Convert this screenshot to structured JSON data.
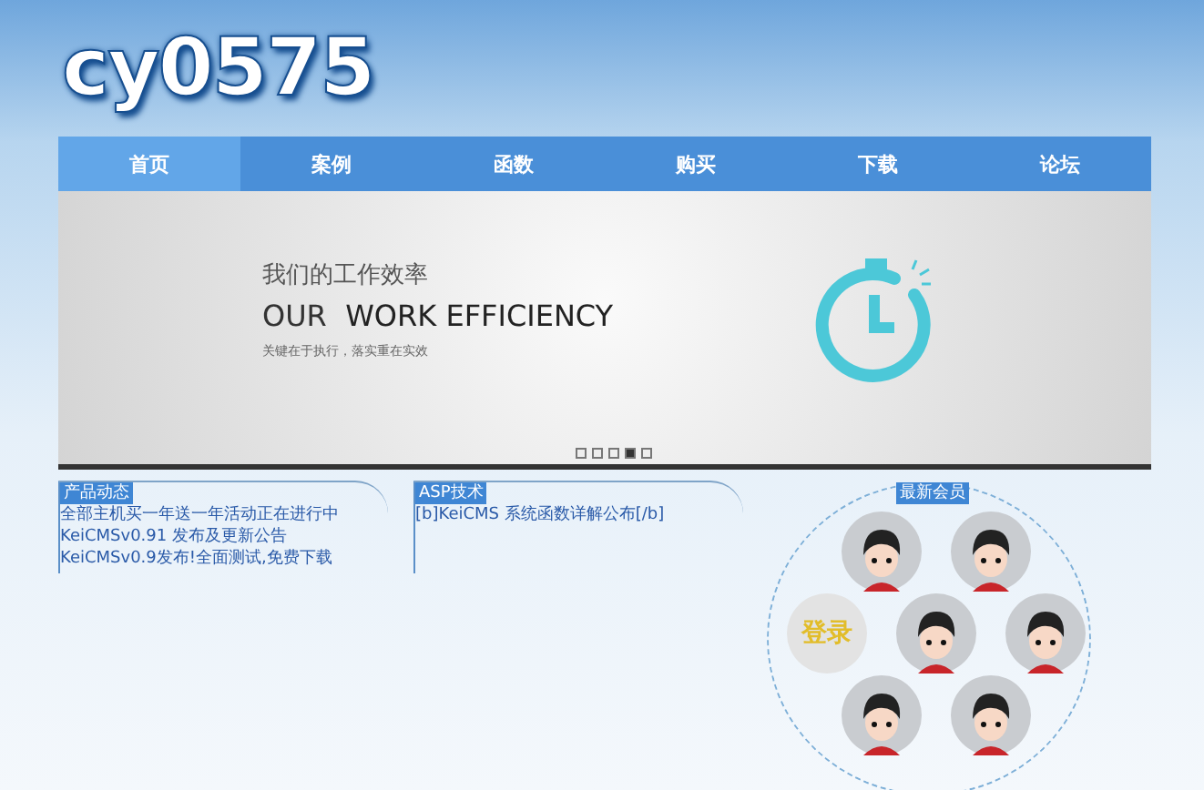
{
  "logo": "cy0575",
  "nav": [
    {
      "label": "首页",
      "selected": true
    },
    {
      "label": "案例",
      "selected": false
    },
    {
      "label": "函数",
      "selected": false
    },
    {
      "label": "购买",
      "selected": false
    },
    {
      "label": "下载",
      "selected": false
    },
    {
      "label": "论坛",
      "selected": false
    }
  ],
  "banner": {
    "title_cn": "我们的工作效率",
    "title_en_light": "OUR",
    "title_en_bold": "WORK EFFICIENCY",
    "subtitle": "关键在于执行，落实重在实效",
    "dots": [
      {
        "selected": false
      },
      {
        "selected": false
      },
      {
        "selected": false
      },
      {
        "selected": true
      },
      {
        "selected": false
      }
    ]
  },
  "panels": [
    {
      "title": "产品动态",
      "items": [
        "全部主机买一年送一年活动正在进行中",
        "KeiCMSv0.91 发布及更新公告",
        "KeiCMSv0.9发布!全面测试,免费下载"
      ]
    },
    {
      "title": "ASP技术",
      "items": [
        "[b]KeiCMS 系统函数详解公布[/b]"
      ]
    }
  ],
  "members": {
    "title": "最新会员",
    "login": "登录"
  }
}
